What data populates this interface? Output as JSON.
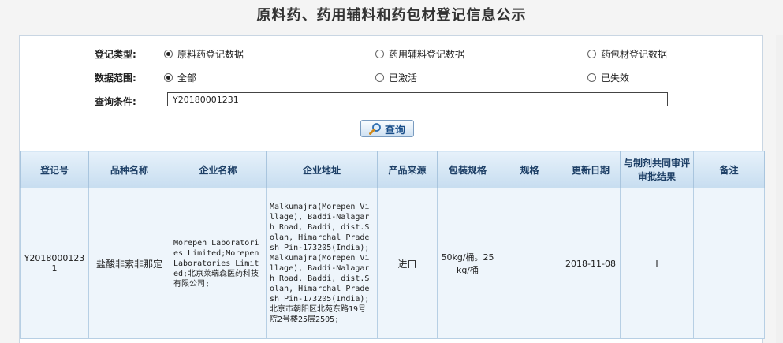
{
  "title": "原料药、药用辅料和药包材登记信息公示",
  "form": {
    "type_label": "登记类型:",
    "type_options": [
      "原料药登记数据",
      "药用辅料登记数据",
      "药包材登记数据"
    ],
    "type_selected": 0,
    "scope_label": "数据范围:",
    "scope_options": [
      "全部",
      "已激活",
      "已失效"
    ],
    "scope_selected": 0,
    "query_label": "查询条件:",
    "query_value": "Y20180001231",
    "search_label": "查询"
  },
  "table": {
    "headers": [
      "登记号",
      "品种名称",
      "企业名称",
      "企业地址",
      "产品来源",
      "包装规格",
      "规格",
      "更新日期",
      "与制剂共同审评审批结果",
      "备注"
    ],
    "rows": [
      {
        "reg_no": "Y20180001231",
        "name": "盐酸非索非那定",
        "company": "Morepen Laboratories Limited;Morepen Laboratories Limited;北京莱瑞森医药科技有限公司;",
        "address": "Malkumajra(Morepen Village), Baddi-Nalagarh Road, Baddi, dist.Solan, Himarchal Pradesh Pin-173205(India);Malkumajra(Morepen Village), Baddi-Nalagarh Road, Baddi, dist.Solan, Himarchal Pradesh Pin-173205(India);北京市朝阳区北苑东路19号院2号楼25层2505;",
        "source": "进口",
        "package": "50kg/桶。25kg/桶",
        "spec": "",
        "date": "2018-11-08",
        "result": "I",
        "remark": ""
      }
    ]
  }
}
